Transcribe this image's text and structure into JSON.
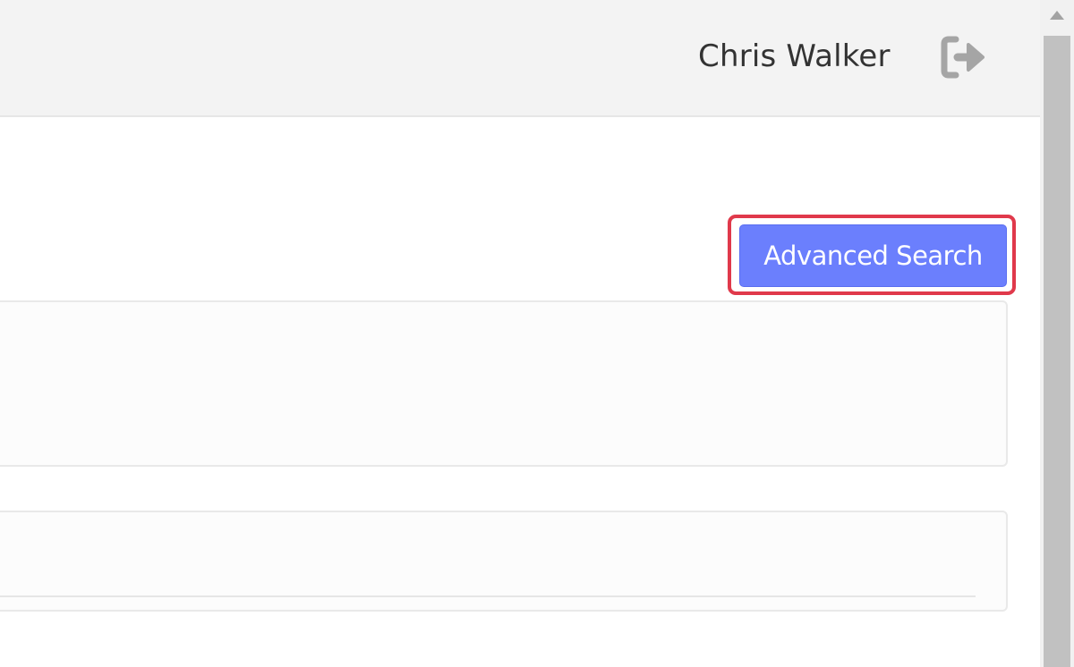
{
  "header": {
    "user_name": "Chris Walker",
    "logout_icon": "logout-icon"
  },
  "toolbar": {
    "advanced_search_label": "Advanced Search"
  },
  "colors": {
    "button_bg": "#6b7ffd",
    "highlight_border": "#e0394b",
    "topbar_bg": "#f3f3f3"
  }
}
